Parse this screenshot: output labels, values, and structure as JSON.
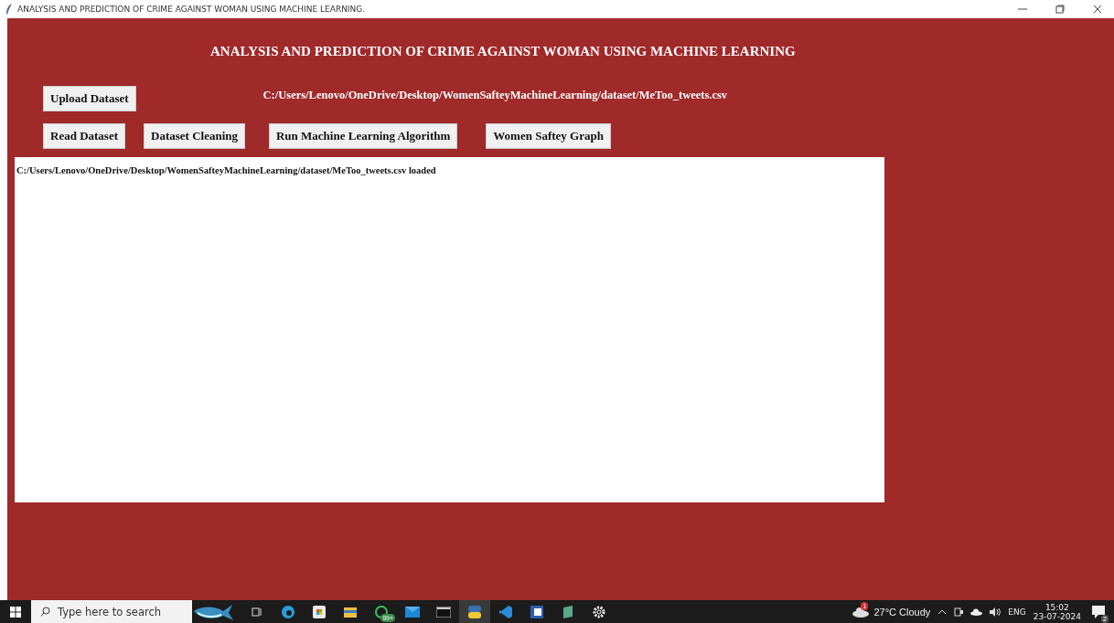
{
  "window": {
    "title": "ANALYSIS AND PREDICTION OF CRIME AGAINST WOMAN USING MACHINE LEARNING."
  },
  "heading": "ANALYSIS AND PREDICTION OF CRIME AGAINST WOMAN USING MACHINE LEARNING",
  "upload_button": "Upload Dataset",
  "path_label": "C:/Users/Lenovo/OneDrive/Desktop/WomenSafteyMachineLearning/dataset/MeToo_tweets.csv",
  "buttons": [
    "Read Dataset",
    "Dataset Cleaning",
    "Run Machine Learning Algorithm",
    "Women Saftey Graph"
  ],
  "output_text": "C:/Users/Lenovo/OneDrive/Desktop/WomenSafteyMachineLearning/dataset/MeToo_tweets.csv loaded",
  "taskbar": {
    "search_placeholder": "Type here to search",
    "whatsapp_badge": "99+",
    "weather_badge": "1",
    "weather": "27°C  Cloudy",
    "language": "ENG",
    "time": "15:02",
    "date": "23-07-2024",
    "notification_count": "2"
  }
}
